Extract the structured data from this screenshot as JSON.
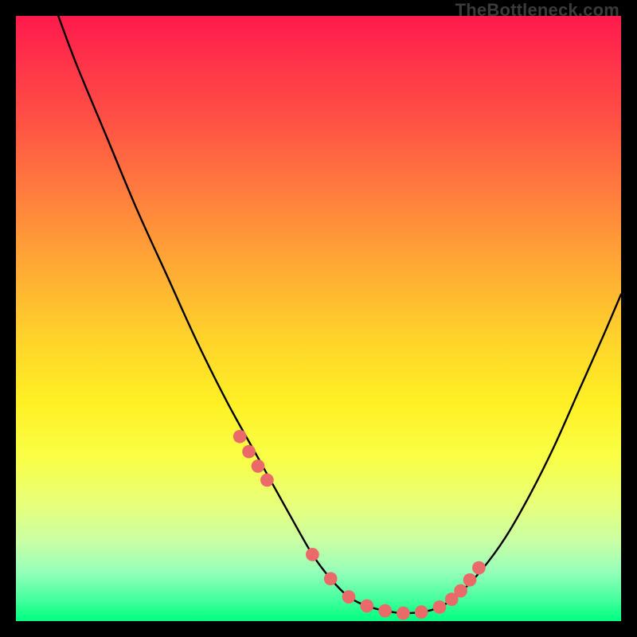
{
  "watermark": "TheBottleneck.com",
  "chart_data": {
    "type": "line",
    "title": "",
    "xlabel": "",
    "ylabel": "",
    "xlim": [
      0,
      100
    ],
    "ylim": [
      0,
      100
    ],
    "grid": false,
    "series": [
      {
        "name": "curve",
        "color": "#000000",
        "x": [
          7,
          10,
          15,
          20,
          25,
          30,
          35,
          40,
          45,
          49,
          52,
          55,
          58,
          61,
          64,
          67,
          70,
          73,
          77,
          81,
          85,
          89,
          93,
          97,
          100
        ],
        "y": [
          100,
          92,
          80,
          68,
          57,
          46,
          36,
          27,
          18,
          11,
          7,
          4,
          2.5,
          1.7,
          1.3,
          1.5,
          2.3,
          4.3,
          8.5,
          14,
          21,
          29,
          38,
          47,
          54
        ]
      }
    ],
    "markers": {
      "name": "dots",
      "color": "#ea6a6a",
      "radius_pct": 1.1,
      "x": [
        37,
        38.5,
        40,
        41.5,
        49,
        52,
        55,
        58,
        61,
        64,
        67,
        70,
        72,
        73.5,
        75,
        76.5
      ],
      "y": [
        30.5,
        28,
        25.6,
        23.3,
        11,
        7,
        4,
        2.5,
        1.7,
        1.3,
        1.5,
        2.3,
        3.6,
        5,
        6.8,
        8.8
      ]
    }
  }
}
